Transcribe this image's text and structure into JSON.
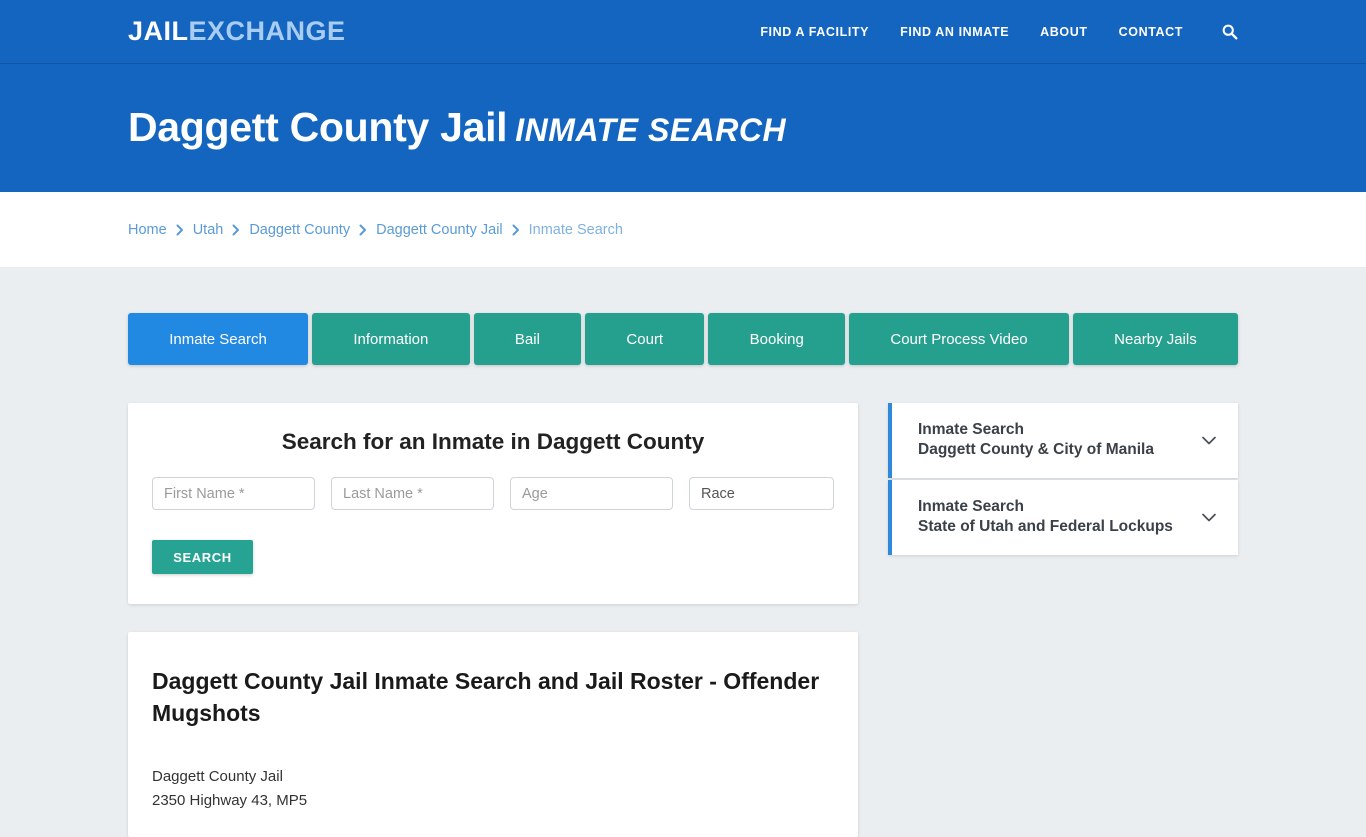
{
  "header": {
    "logo_primary": "JAIL",
    "logo_secondary": "EXCHANGE",
    "nav": [
      {
        "label": "FIND A FACILITY"
      },
      {
        "label": "FIND AN INMATE"
      },
      {
        "label": "ABOUT"
      },
      {
        "label": "CONTACT"
      }
    ],
    "search_icon": "search-icon"
  },
  "hero": {
    "title": "Daggett County Jail",
    "subtitle": "Inmate Search"
  },
  "breadcrumb": {
    "separator": "›",
    "items": [
      {
        "label": "Home",
        "current": false
      },
      {
        "label": "Utah",
        "current": false
      },
      {
        "label": "Daggett County",
        "current": false
      },
      {
        "label": "Daggett County Jail",
        "current": false
      },
      {
        "label": "Inmate Search",
        "current": true
      }
    ]
  },
  "tabs": {
    "active_index": 0,
    "active_color": "#2289e2",
    "inactive_color": "#26a08e",
    "items": [
      {
        "label": "Inmate Search"
      },
      {
        "label": "Information"
      },
      {
        "label": "Bail"
      },
      {
        "label": "Court"
      },
      {
        "label": "Booking"
      },
      {
        "label": "Court Process Video"
      },
      {
        "label": "Nearby Jails"
      }
    ]
  },
  "search_form": {
    "heading": "Search for an Inmate in Daggett County",
    "first_name_placeholder": "First Name *",
    "last_name_placeholder": "Last Name *",
    "age_placeholder": "Age",
    "race_selected": "Race",
    "race_options": [
      "Race"
    ],
    "submit_label": "SEARCH"
  },
  "article": {
    "title": "Daggett County Jail Inmate Search and Jail Roster - Offender Mugshots",
    "line1": "Daggett County Jail",
    "line2": "2350 Highway 43, MP5"
  },
  "sidebar": {
    "accent_color": "#2e8ad8",
    "items": [
      {
        "line1": "Inmate Search",
        "line2": "Daggett County & City of Manila",
        "icon": "chevron-down-icon"
      },
      {
        "line1": "Inmate Search",
        "line2": "State of Utah and Federal Lockups",
        "icon": "chevron-down-icon"
      }
    ]
  }
}
